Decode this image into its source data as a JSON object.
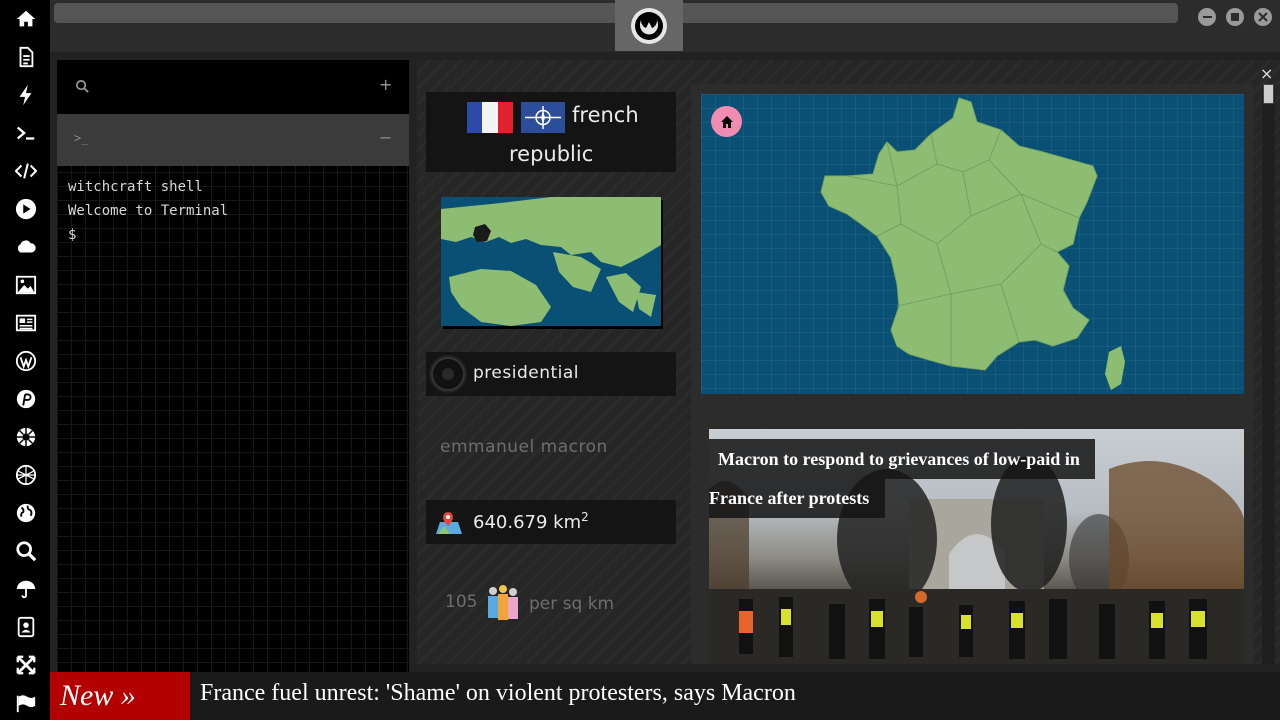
{
  "sidebar": {
    "icons": [
      "home-icon",
      "document-icon",
      "bolt-icon",
      "terminal-icon",
      "code-icon",
      "play-icon",
      "cloud-icon",
      "image-icon",
      "newspaper-icon",
      "wordpress-icon",
      "pinterest-icon",
      "galactic-empire-icon",
      "death-star-icon",
      "globe-icon",
      "search-icon",
      "umbrella-icon",
      "contact-book-icon",
      "move-icon",
      "flag-icon"
    ]
  },
  "window": {
    "close_symbol": "×"
  },
  "terminal": {
    "search_icon": "search-icon",
    "add_symbol": "+",
    "prompt_symbol": ">_",
    "collapse_symbol": "−",
    "lines": [
      "witchcraft shell",
      "Welcome to Terminal",
      "$"
    ]
  },
  "country": {
    "name_line1": "french",
    "name_line2": "republic",
    "flags": [
      "flag-france-icon",
      "flag-nato-icon"
    ],
    "government": "presidential",
    "leader": "emmanuel macron",
    "area_value": "640.679 km",
    "area_exponent": "2",
    "density_value": "105",
    "density_unit": "per sq km"
  },
  "news": {
    "headline_line1": "Macron to respond to grievances of low-paid in",
    "headline_line2": "France after protests"
  },
  "ticker": {
    "label": "New »",
    "text": "France fuel unrest: 'Shame' on violent protesters, says Macron"
  },
  "colors": {
    "accent_red": "#b30000",
    "map_water": "#0a5074",
    "map_land": "#8dbd73",
    "home_badge": "#f08bb1"
  }
}
